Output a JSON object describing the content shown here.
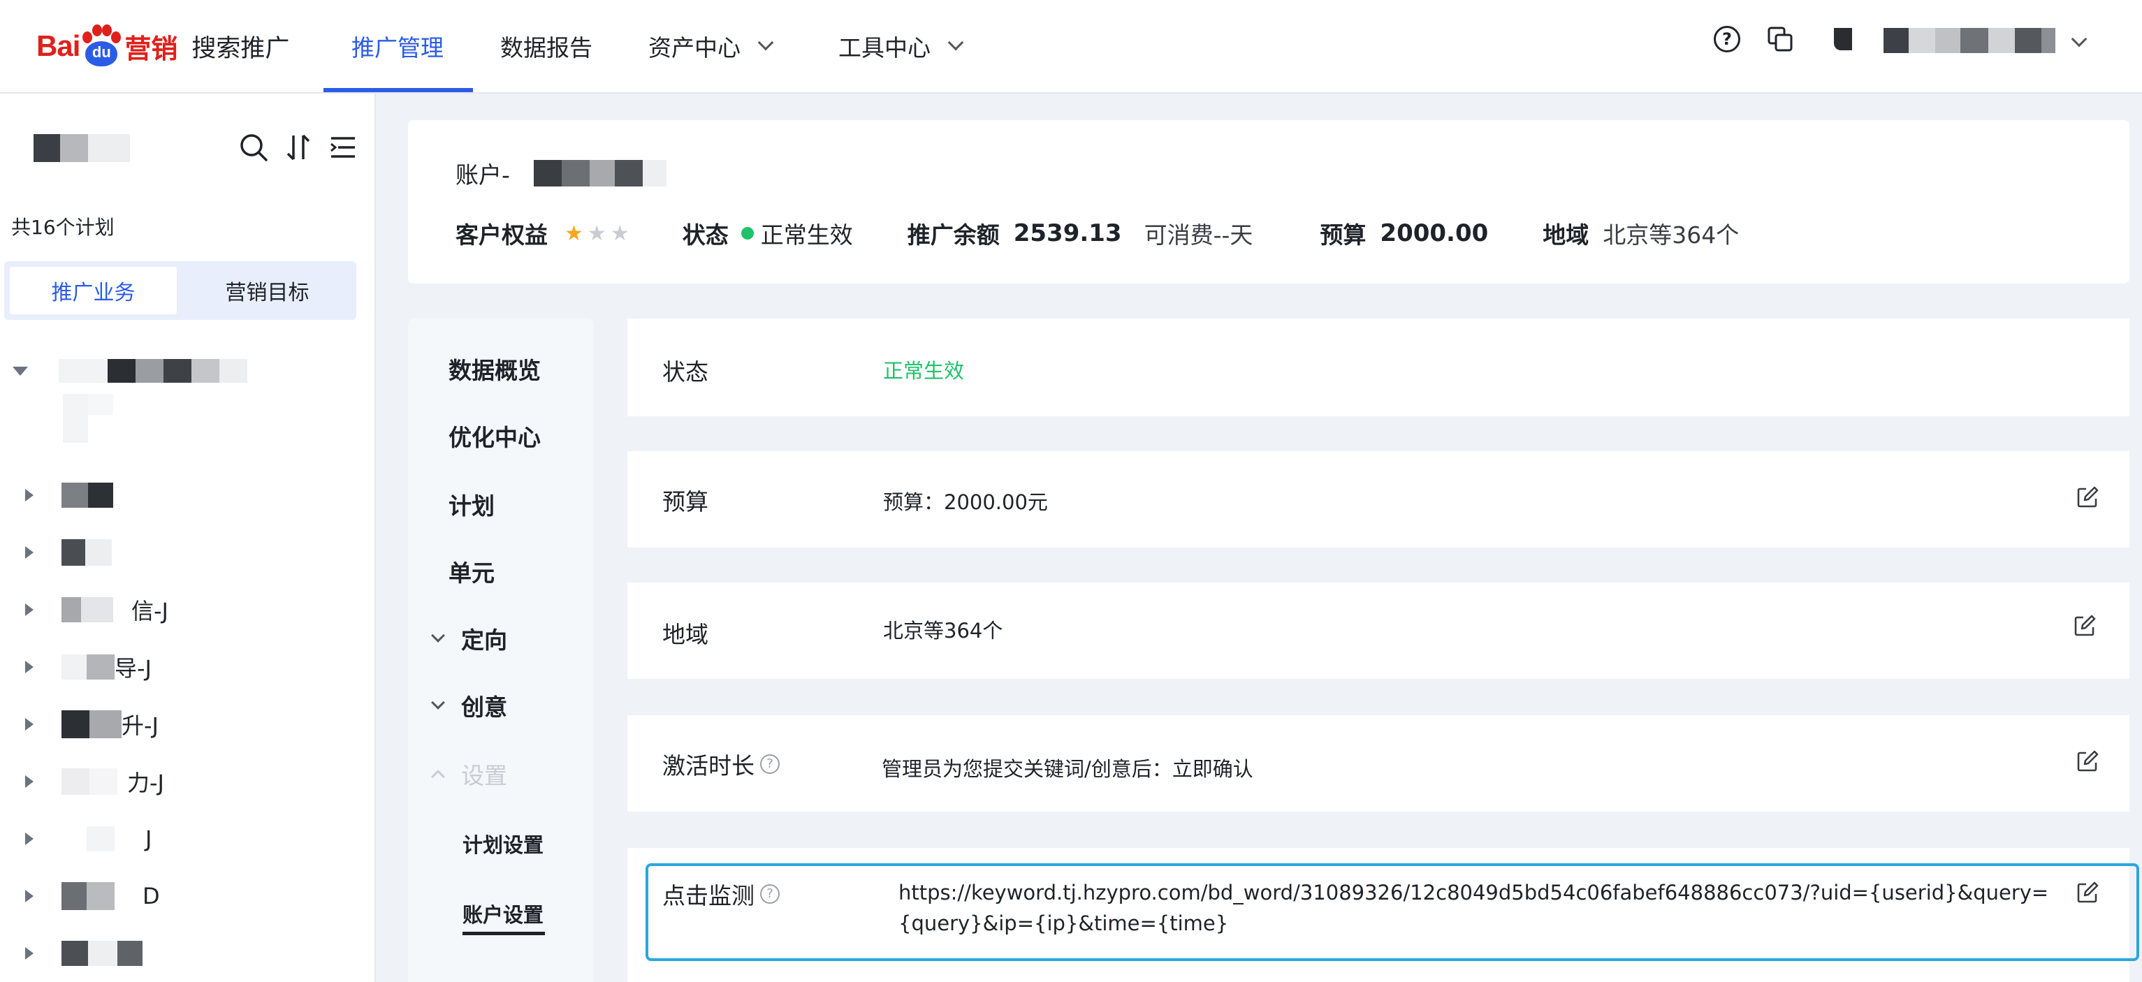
{
  "header": {
    "logo_bai": "Bai",
    "logo_du": "du",
    "logo_yingxiao": "营销",
    "product_name": "搜索推广",
    "nav": [
      {
        "label": "推广管理",
        "active": true
      },
      {
        "label": "数据报告"
      },
      {
        "label": "资产中心"
      },
      {
        "label": "工具中心"
      }
    ],
    "help_icon": "?",
    "icons": [
      "help-icon",
      "copy-windows-icon",
      "user-avatar-icon",
      "chevron-down-icon"
    ]
  },
  "sidebar": {
    "plan_count": "共16个计划",
    "tabs": [
      {
        "label": "推广业务",
        "active": true
      },
      {
        "label": "营销目标"
      }
    ],
    "tree_items": [
      {
        "label": ""
      },
      {
        "label": ""
      },
      {
        "label": "信-J"
      },
      {
        "label": "导-J"
      },
      {
        "label": "升-J"
      },
      {
        "label": "力-J"
      },
      {
        "label": "J"
      },
      {
        "label": "D"
      },
      {
        "label": ""
      }
    ],
    "tools": [
      "search-icon",
      "sort-icon",
      "filter-list-icon"
    ]
  },
  "account": {
    "name_label": "账户-",
    "rights_label": "客户权益",
    "rating": 1,
    "rating_max": 3,
    "status_label": "状态",
    "status_value": "正常生效",
    "balance_label": "推广余额",
    "balance_value": "2539.13",
    "consumable_text": "可消费--天",
    "budget_label": "预算",
    "budget_value": "2000.00",
    "region_label": "地域",
    "region_value": "北京等364个"
  },
  "subnav": {
    "items": [
      {
        "label": "数据概览"
      },
      {
        "label": "优化中心"
      },
      {
        "label": "计划"
      },
      {
        "label": "单元"
      },
      {
        "label": "定向"
      },
      {
        "label": "创意"
      },
      {
        "label": "设置"
      },
      {
        "label": "计划设置"
      },
      {
        "label": "账户设置",
        "active": true
      }
    ]
  },
  "settings": {
    "status": {
      "label": "状态",
      "value": "正常生效",
      "value_color": "#1ec26a"
    },
    "budget": {
      "label": "预算",
      "value": "预算：2000.00元"
    },
    "region": {
      "label": "地域",
      "value": "北京等364个"
    },
    "activation": {
      "label": "激活时长",
      "value": "管理员为您提交关键词/创意后：立即确认"
    },
    "click_monitor": {
      "label": "点击监测",
      "value_line1": "https://keyword.tj.hzypro.com/bd_word/31089326/12c8049d5bd54c06fabef648886cc073/?uid={userid}&query=",
      "value_line2": "{query}&ip={ip}&time={time}"
    }
  },
  "colors": {
    "accent": "#2b5ce6",
    "brand_red": "#e0201b",
    "status_green": "#1ec26a",
    "highlight_border": "#29a7e1",
    "star_active": "#f5a623",
    "star_inactive": "#c9ccd3"
  }
}
